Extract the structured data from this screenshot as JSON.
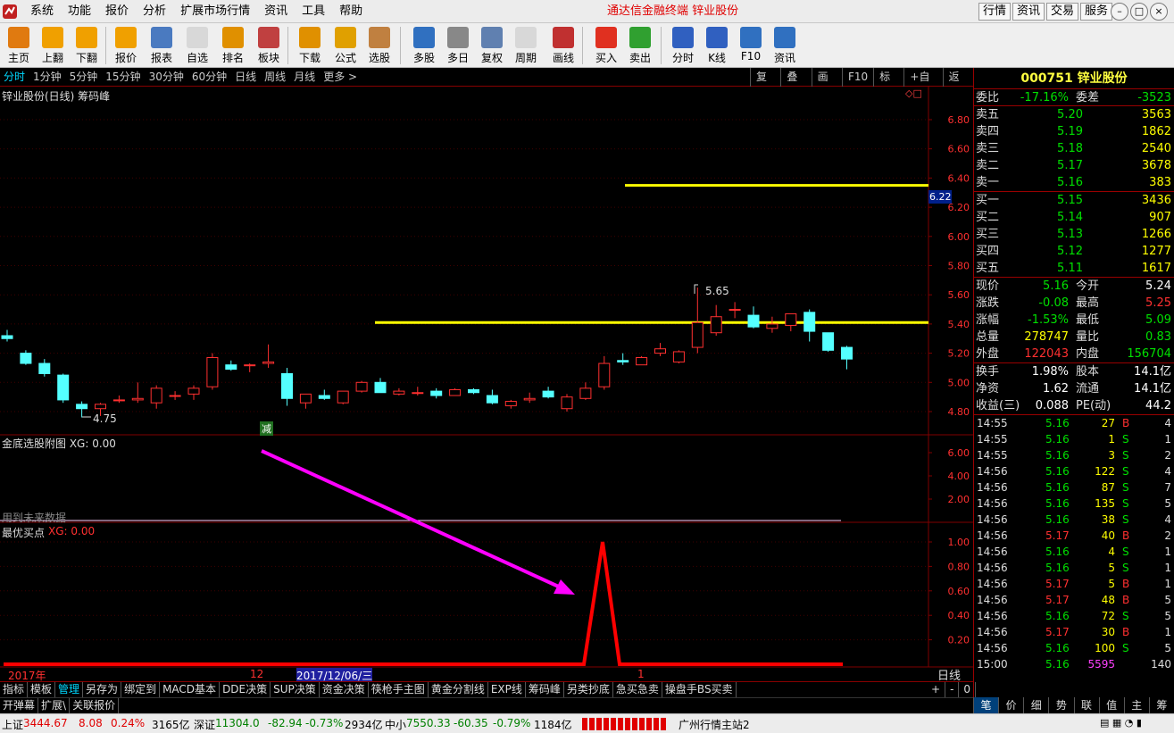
{
  "menubar": {
    "items": [
      "系统",
      "功能",
      "报价",
      "分析",
      "扩展市场行情",
      "资讯",
      "工具",
      "帮助"
    ],
    "title": "通达信金融终端   锌业股份",
    "right_buttons": [
      "行情",
      "资讯",
      "交易",
      "服务"
    ]
  },
  "toolbar": {
    "buttons": [
      {
        "label": "主页",
        "icon": "home-icon",
        "color": "#e07a10"
      },
      {
        "label": "上翻",
        "icon": "arrow-up-icon",
        "color": "#f0a000"
      },
      {
        "label": "下翻",
        "icon": "arrow-down-icon",
        "color": "#f0a000"
      },
      {
        "label": "报价",
        "icon": "yen-icon",
        "color": "#f0a000"
      },
      {
        "label": "报表",
        "icon": "report-icon",
        "color": "#4a7ac0"
      },
      {
        "label": "自选",
        "icon": "f6-icon",
        "color": "#d8d8d8"
      },
      {
        "label": "排名",
        "icon": "rank-icon",
        "color": "#e09000"
      },
      {
        "label": "板块",
        "icon": "blocks-icon",
        "color": "#c04040"
      },
      {
        "label": "下载",
        "icon": "download-icon",
        "color": "#e09000"
      },
      {
        "label": "公式",
        "icon": "formula-icon",
        "color": "#e0a000"
      },
      {
        "label": "选股",
        "icon": "select-stock-icon",
        "color": "#c08040"
      },
      {
        "label": "多股",
        "icon": "multi-stock-icon",
        "color": "#3070c0"
      },
      {
        "label": "多日",
        "icon": "clock-icon",
        "color": "#888888"
      },
      {
        "label": "复权",
        "icon": "restore-icon",
        "color": "#6080b0"
      },
      {
        "label": "周期",
        "icon": "f8-icon",
        "color": "#d8d8d8"
      },
      {
        "label": "画线",
        "icon": "draw-line-icon",
        "color": "#c03030"
      },
      {
        "label": "买入",
        "icon": "buy-icon",
        "color": "#e03020"
      },
      {
        "label": "卖出",
        "icon": "sell-icon",
        "color": "#30a030"
      },
      {
        "label": "分时",
        "icon": "intraday-icon",
        "color": "#3060c0"
      },
      {
        "label": "K线",
        "icon": "kline-icon",
        "color": "#3060c0"
      },
      {
        "label": "F10",
        "icon": "f10-icon",
        "color": "#3070c0"
      },
      {
        "label": "资讯",
        "icon": "news-icon",
        "color": "#3070c0"
      }
    ]
  },
  "periodbar": {
    "periods": [
      "分时",
      "1分钟",
      "5分钟",
      "15分钟",
      "30分钟",
      "60分钟",
      "日线",
      "周线",
      "月线",
      "更多 >"
    ],
    "active": "分时",
    "tools": [
      "复权",
      "叠加",
      "画线",
      "F10",
      "标记",
      "+自选",
      "返回"
    ]
  },
  "chart": {
    "main_title": "锌业股份(日线) 筹码峰",
    "main_axis": [
      "6.80",
      "6.60",
      "6.40",
      "6.20",
      "6.00",
      "5.80",
      "5.60",
      "5.40",
      "5.20",
      "5.00",
      "4.80"
    ],
    "current_price_tag": "6.22",
    "high_label": "5.65",
    "low_label": "4.75",
    "reduce_marker": "减",
    "sub1_title": "金底选股附图  XG: 0.00",
    "sub1_axis": [
      "6.00",
      "4.00",
      "2.00"
    ],
    "sub1_note": "用到未来数据",
    "sub2_title": "最优买点",
    "sub2_value": "XG: 0.00",
    "sub2_axis": [
      "1.00",
      "0.80",
      "0.60",
      "0.40",
      "0.20"
    ],
    "date_labels": [
      "2017年",
      "12",
      "2017/12/06/三",
      "1"
    ],
    "period_label": "日线"
  },
  "chart_data": {
    "type": "candlestick",
    "price_range": [
      4.75,
      6.8
    ],
    "candles": [
      {
        "o": 5.32,
        "h": 5.36,
        "l": 5.28,
        "c": 5.3
      },
      {
        "o": 5.2,
        "h": 5.22,
        "l": 5.12,
        "c": 5.13
      },
      {
        "o": 5.13,
        "h": 5.16,
        "l": 5.04,
        "c": 5.06
      },
      {
        "o": 5.05,
        "h": 5.06,
        "l": 4.86,
        "c": 4.88
      },
      {
        "o": 4.85,
        "h": 4.87,
        "l": 4.76,
        "c": 4.82
      },
      {
        "o": 4.82,
        "h": 4.86,
        "l": 4.77,
        "c": 4.85
      },
      {
        "o": 4.88,
        "h": 4.91,
        "l": 4.86,
        "c": 4.88
      },
      {
        "o": 4.88,
        "h": 5.0,
        "l": 4.86,
        "c": 4.89
      },
      {
        "o": 4.86,
        "h": 4.98,
        "l": 4.82,
        "c": 4.96
      },
      {
        "o": 4.91,
        "h": 4.94,
        "l": 4.88,
        "c": 4.91
      },
      {
        "o": 4.92,
        "h": 4.98,
        "l": 4.88,
        "c": 4.96
      },
      {
        "o": 4.97,
        "h": 5.2,
        "l": 4.95,
        "c": 5.17
      },
      {
        "o": 5.12,
        "h": 5.15,
        "l": 5.08,
        "c": 5.09
      },
      {
        "o": 5.12,
        "h": 5.13,
        "l": 5.07,
        "c": 5.12
      },
      {
        "o": 5.13,
        "h": 5.26,
        "l": 5.1,
        "c": 5.14
      },
      {
        "o": 5.06,
        "h": 5.1,
        "l": 4.84,
        "c": 4.89
      },
      {
        "o": 4.86,
        "h": 4.92,
        "l": 4.82,
        "c": 4.92
      },
      {
        "o": 4.91,
        "h": 4.95,
        "l": 4.88,
        "c": 4.89
      },
      {
        "o": 4.86,
        "h": 4.94,
        "l": 4.85,
        "c": 4.94
      },
      {
        "o": 4.94,
        "h": 5.01,
        "l": 4.93,
        "c": 5.0
      },
      {
        "o": 5.0,
        "h": 5.03,
        "l": 4.93,
        "c": 4.93
      },
      {
        "o": 4.92,
        "h": 4.96,
        "l": 4.91,
        "c": 4.94
      },
      {
        "o": 4.93,
        "h": 4.97,
        "l": 4.91,
        "c": 4.93
      },
      {
        "o": 4.94,
        "h": 4.96,
        "l": 4.89,
        "c": 4.91
      },
      {
        "o": 4.91,
        "h": 4.96,
        "l": 4.91,
        "c": 4.95
      },
      {
        "o": 4.95,
        "h": 4.96,
        "l": 4.92,
        "c": 4.93
      },
      {
        "o": 4.91,
        "h": 4.95,
        "l": 4.85,
        "c": 4.86
      },
      {
        "o": 4.84,
        "h": 4.88,
        "l": 4.82,
        "c": 4.87
      },
      {
        "o": 4.88,
        "h": 4.93,
        "l": 4.86,
        "c": 4.89
      },
      {
        "o": 4.94,
        "h": 4.97,
        "l": 4.89,
        "c": 4.9
      },
      {
        "o": 4.82,
        "h": 4.92,
        "l": 4.8,
        "c": 4.9
      },
      {
        "o": 4.89,
        "h": 5.0,
        "l": 4.88,
        "c": 4.96
      },
      {
        "o": 4.97,
        "h": 5.18,
        "l": 4.95,
        "c": 5.13
      },
      {
        "o": 5.15,
        "h": 5.2,
        "l": 5.12,
        "c": 5.14
      },
      {
        "o": 5.12,
        "h": 5.18,
        "l": 5.12,
        "c": 5.17
      },
      {
        "o": 5.2,
        "h": 5.27,
        "l": 5.18,
        "c": 5.23
      },
      {
        "o": 5.14,
        "h": 5.22,
        "l": 5.13,
        "c": 5.21
      },
      {
        "o": 5.24,
        "h": 5.65,
        "l": 5.2,
        "c": 5.41
      },
      {
        "o": 5.34,
        "h": 5.53,
        "l": 5.32,
        "c": 5.45
      },
      {
        "o": 5.5,
        "h": 5.55,
        "l": 5.44,
        "c": 5.5
      },
      {
        "o": 5.46,
        "h": 5.52,
        "l": 5.37,
        "c": 5.38
      },
      {
        "o": 5.37,
        "h": 5.45,
        "l": 5.34,
        "c": 5.4
      },
      {
        "o": 5.39,
        "h": 5.47,
        "l": 5.35,
        "c": 5.47
      },
      {
        "o": 5.48,
        "h": 5.5,
        "l": 5.28,
        "c": 5.35
      },
      {
        "o": 5.34,
        "h": 5.34,
        "l": 5.21,
        "c": 5.22
      },
      {
        "o": 5.24,
        "h": 5.25,
        "l": 5.09,
        "c": 5.16
      }
    ],
    "levels": [
      6.35,
      5.41
    ],
    "signal": {
      "series": "最优买点",
      "peak_value": 1.0,
      "baseline": 0
    }
  },
  "quote": {
    "code_name": "000751 锌业股份",
    "weibi_label": "委比",
    "weibi": "-17.16%",
    "weicha_label": "委差",
    "weicha": "-3523",
    "asks": [
      {
        "label": "卖五",
        "price": "5.20",
        "vol": "3563"
      },
      {
        "label": "卖四",
        "price": "5.19",
        "vol": "1862"
      },
      {
        "label": "卖三",
        "price": "5.18",
        "vol": "2540"
      },
      {
        "label": "卖二",
        "price": "5.17",
        "vol": "3678"
      },
      {
        "label": "卖一",
        "price": "5.16",
        "vol": "383"
      }
    ],
    "bids": [
      {
        "label": "买一",
        "price": "5.15",
        "vol": "3436"
      },
      {
        "label": "买二",
        "price": "5.14",
        "vol": "907"
      },
      {
        "label": "买三",
        "price": "5.13",
        "vol": "1266"
      },
      {
        "label": "买四",
        "price": "5.12",
        "vol": "1277"
      },
      {
        "label": "买五",
        "price": "5.11",
        "vol": "1617"
      }
    ],
    "stats": [
      {
        "l1": "现价",
        "v1": "5.16",
        "c1": "#00e000",
        "l2": "今开",
        "v2": "5.24",
        "c2": "#ffffff"
      },
      {
        "l1": "涨跌",
        "v1": "-0.08",
        "c1": "#00e000",
        "l2": "最高",
        "v2": "5.25",
        "c2": "#ff3030"
      },
      {
        "l1": "涨幅",
        "v1": "-1.53%",
        "c1": "#00e000",
        "l2": "最低",
        "v2": "5.09",
        "c2": "#00e000"
      },
      {
        "l1": "总量",
        "v1": "278747",
        "c1": "#ffff00",
        "l2": "量比",
        "v2": "0.83",
        "c2": "#00e000"
      },
      {
        "l1": "外盘",
        "v1": "122043",
        "c1": "#ff3030",
        "l2": "内盘",
        "v2": "156704",
        "c2": "#00e000"
      }
    ],
    "stats2": [
      {
        "l1": "换手",
        "v1": "1.98%",
        "c1": "#ffffff",
        "l2": "股本",
        "v2": "14.1亿",
        "c2": "#ffffff"
      },
      {
        "l1": "净资",
        "v1": "1.62",
        "c1": "#ffffff",
        "l2": "流通",
        "v2": "14.1亿",
        "c2": "#ffffff"
      },
      {
        "l1": "收益(三)",
        "v1": "0.088",
        "c1": "#ffffff",
        "l2": "PE(动)",
        "v2": "44.2",
        "c2": "#ffffff"
      }
    ],
    "ticks": [
      {
        "t": "14:55",
        "p": "5.16",
        "v": "27",
        "s": "B",
        "n": "4"
      },
      {
        "t": "14:55",
        "p": "5.16",
        "v": "1",
        "s": "S",
        "n": "1"
      },
      {
        "t": "14:55",
        "p": "5.16",
        "v": "3",
        "s": "S",
        "n": "2"
      },
      {
        "t": "14:56",
        "p": "5.16",
        "v": "122",
        "s": "S",
        "n": "4"
      },
      {
        "t": "14:56",
        "p": "5.16",
        "v": "87",
        "s": "S",
        "n": "7"
      },
      {
        "t": "14:56",
        "p": "5.16",
        "v": "135",
        "s": "S",
        "n": "5"
      },
      {
        "t": "14:56",
        "p": "5.16",
        "v": "38",
        "s": "S",
        "n": "4"
      },
      {
        "t": "14:56",
        "p": "5.17",
        "v": "40",
        "s": "B",
        "n": "2"
      },
      {
        "t": "14:56",
        "p": "5.16",
        "v": "4",
        "s": "S",
        "n": "1"
      },
      {
        "t": "14:56",
        "p": "5.16",
        "v": "5",
        "s": "S",
        "n": "1"
      },
      {
        "t": "14:56",
        "p": "5.17",
        "v": "5",
        "s": "B",
        "n": "1"
      },
      {
        "t": "14:56",
        "p": "5.17",
        "v": "48",
        "s": "B",
        "n": "5"
      },
      {
        "t": "14:56",
        "p": "5.16",
        "v": "72",
        "s": "S",
        "n": "5"
      },
      {
        "t": "14:56",
        "p": "5.17",
        "v": "30",
        "s": "B",
        "n": "1"
      },
      {
        "t": "14:56",
        "p": "5.16",
        "v": "100",
        "s": "S",
        "n": "5"
      },
      {
        "t": "15:00",
        "p": "5.16",
        "v": "5595",
        "s": "",
        "n": "140"
      }
    ],
    "tabs": [
      "笔",
      "价",
      "细",
      "势",
      "联",
      "值",
      "主",
      "筹"
    ]
  },
  "bottom": {
    "tabs1": [
      "指标",
      "模板",
      "管理",
      "另存为",
      "绑定到",
      "MACD基本",
      "DDE决策",
      "SUP决策",
      "资金决策",
      "筷枪手主图",
      "黄金分割线",
      "EXP线",
      "筹码峰",
      "另类抄底",
      "急买急卖",
      "操盘手BS买卖"
    ],
    "tabs1_active": "管理",
    "tabs1_right": [
      "+",
      "-",
      "0"
    ],
    "tabs2": [
      "开弹幕",
      "扩展\\",
      "关联报价"
    ],
    "status": {
      "sh_label": "上证",
      "sh": "3444.67",
      "sh_chg": "8.08",
      "sh_pct": "0.24%",
      "sh_amt": "3165亿",
      "sz_label": "深证",
      "sz": "11304.0",
      "sz_chg": "-82.94",
      "sz_pct": "-0.73%",
      "sz_amt": "2934亿",
      "zx_label": "中小",
      "zx": "7550.33",
      "zx_chg": "-60.35",
      "zx_pct": "-0.79%",
      "zx_amt": "1184亿",
      "server": "广州行情主站2"
    }
  },
  "colors": {
    "up": "#ff3030",
    "down": "#54ffff",
    "level": "#ffff00",
    "signal": "#ff0000",
    "arrow": "#ff00ff",
    "grid": "#800000"
  }
}
